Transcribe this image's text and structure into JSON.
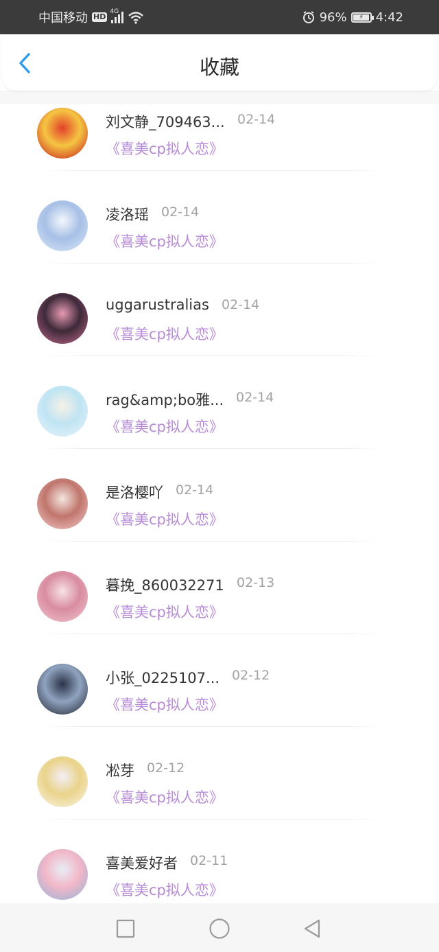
{
  "status_bar": {
    "carrier": "中国移动",
    "hd": "HD",
    "network": "4G",
    "battery_percent_text": "96%",
    "battery_level": 0.96,
    "time": "4:42"
  },
  "header": {
    "title": "收藏",
    "back_icon": "chevron-left-icon",
    "accent_color": "#2e9bea"
  },
  "favorites": [
    {
      "name": "刘文静_709463...",
      "date": "02-14",
      "link": "《喜美cp拟人恋》",
      "avatar_colors": [
        "#c4161c",
        "#f5c542",
        "#e3402a"
      ]
    },
    {
      "name": "凌洛瑶",
      "date": "02-14",
      "link": "《喜美cp拟人恋》",
      "avatar_colors": [
        "#dbe6f7",
        "#a7c0e6",
        "#f4f7fc"
      ]
    },
    {
      "name": "uggarustralias",
      "date": "02-14",
      "link": "《喜美cp拟人恋》",
      "avatar_colors": [
        "#c46a8c",
        "#3e2a3a",
        "#e79ab2"
      ]
    },
    {
      "name": "rag&amp;bo雅...",
      "date": "02-14",
      "link": "《喜美cp拟人恋》",
      "avatar_colors": [
        "#eaf5fb",
        "#bfe4f3",
        "#f7f1e6"
      ]
    },
    {
      "name": "是洛樱吖",
      "date": "02-14",
      "link": "《喜美cp拟人恋》",
      "avatar_colors": [
        "#f6cfcf",
        "#c0756c",
        "#f3e6e0"
      ]
    },
    {
      "name": "暮挽_860032271",
      "date": "02-13",
      "link": "《喜美cp拟人恋》",
      "avatar_colors": [
        "#f0c6cf",
        "#d98ca0",
        "#f7e2e6"
      ]
    },
    {
      "name": "小张_0225107...",
      "date": "02-12",
      "link": "《喜美cp拟人恋》",
      "avatar_colors": [
        "#1d1f2a",
        "#8fa3bf",
        "#2c3348"
      ]
    },
    {
      "name": "凇芽",
      "date": "02-12",
      "link": "《喜美cp拟人恋》",
      "avatar_colors": [
        "#fbf6e8",
        "#e9d38a",
        "#f4eef7"
      ]
    },
    {
      "name": "喜美爱好者",
      "date": "02-11",
      "link": "《喜美cp拟人恋》",
      "avatar_colors": [
        "#8fb4d9",
        "#f2b7c8",
        "#e7eef6"
      ]
    }
  ],
  "nav": {
    "recent_icon": "square-icon",
    "home_icon": "circle-icon",
    "back_icon": "triangle-back-icon"
  }
}
